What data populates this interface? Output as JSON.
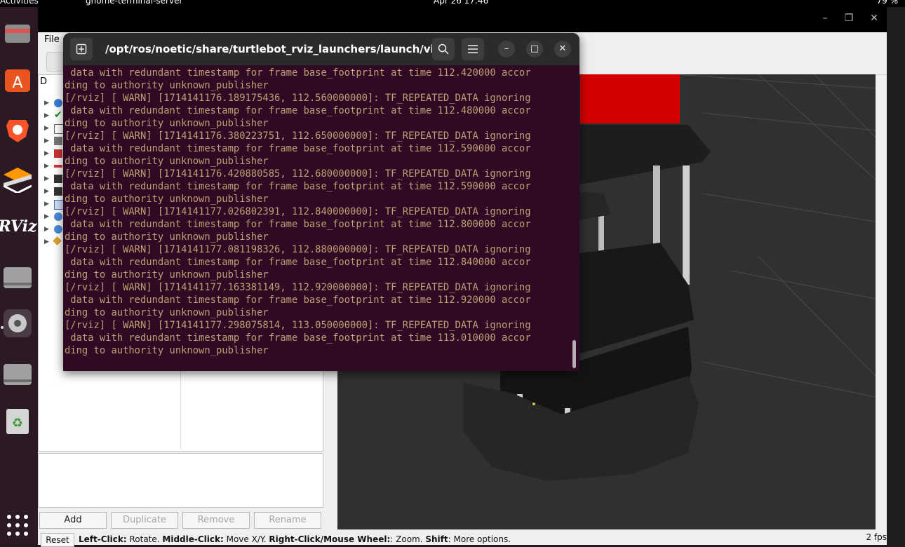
{
  "topbar": {
    "activities": "Activities",
    "app": "gnome-terminal-server",
    "clock": "Apr 26  17:46",
    "battery": "79 %"
  },
  "dock": {
    "items": [
      "files-icon",
      "app-center-icon",
      "brave-icon",
      "sublime-icon",
      "rviz-icon",
      "drive-icon",
      "settings-icon",
      "drive2-icon",
      "trash-icon",
      "apps-grid-icon"
    ],
    "rviz_label": "RViz"
  },
  "rviz": {
    "menu_file": "File",
    "displays_header": "D",
    "buttons": {
      "add": "Add",
      "duplicate": "Duplicate",
      "remove": "Remove",
      "rename": "Rename",
      "reset": "Reset"
    },
    "status": {
      "b1": "Left-Click:",
      "t1": " Rotate. ",
      "b2": "Middle-Click:",
      "t2": " Move X/Y. ",
      "b3": "Right-Click/Mouse Wheel:",
      "t3": ": Zoom. ",
      "b4": "Shift",
      "t4": ": More options."
    },
    "fps": "2 fps",
    "colors": {
      "chrome": "#efefef",
      "viewport": "#303030",
      "robot": "#1b1b1b",
      "red_panel": "#d40000"
    }
  },
  "terminal": {
    "title": "/opt/ros/noetic/share/turtlebot_rviz_launchers/launch/view...",
    "lines": [
      " data with redundant timestamp for frame base_footprint at time 112.420000 accor",
      "ding to authority unknown_publisher",
      "[/rviz] [ WARN] [1714141176.189175436, 112.560000000]: TF_REPEATED_DATA ignoring",
      " data with redundant timestamp for frame base_footprint at time 112.480000 accor",
      "ding to authority unknown_publisher",
      "[/rviz] [ WARN] [1714141176.380223751, 112.650000000]: TF_REPEATED_DATA ignoring",
      " data with redundant timestamp for frame base_footprint at time 112.590000 accor",
      "ding to authority unknown_publisher",
      "[/rviz] [ WARN] [1714141176.420880585, 112.680000000]: TF_REPEATED_DATA ignoring",
      " data with redundant timestamp for frame base_footprint at time 112.590000 accor",
      "ding to authority unknown_publisher",
      "[/rviz] [ WARN] [1714141177.026802391, 112.840000000]: TF_REPEATED_DATA ignoring",
      " data with redundant timestamp for frame base_footprint at time 112.800000 accor",
      "ding to authority unknown_publisher",
      "[/rviz] [ WARN] [1714141177.081198326, 112.880000000]: TF_REPEATED_DATA ignoring",
      " data with redundant timestamp for frame base_footprint at time 112.840000 accor",
      "ding to authority unknown_publisher",
      "[/rviz] [ WARN] [1714141177.163381149, 112.920000000]: TF_REPEATED_DATA ignoring",
      " data with redundant timestamp for frame base_footprint at time 112.920000 accor",
      "ding to authority unknown_publisher",
      "[/rviz] [ WARN] [1714141177.298075814, 113.050000000]: TF_REPEATED_DATA ignoring",
      " data with redundant timestamp for frame base_footprint at time 113.010000 accor",
      "ding to authority unknown_publisher"
    ],
    "colors": {
      "background": "#300a24",
      "header": "#2b2b2b",
      "text": "#c09f74"
    }
  }
}
